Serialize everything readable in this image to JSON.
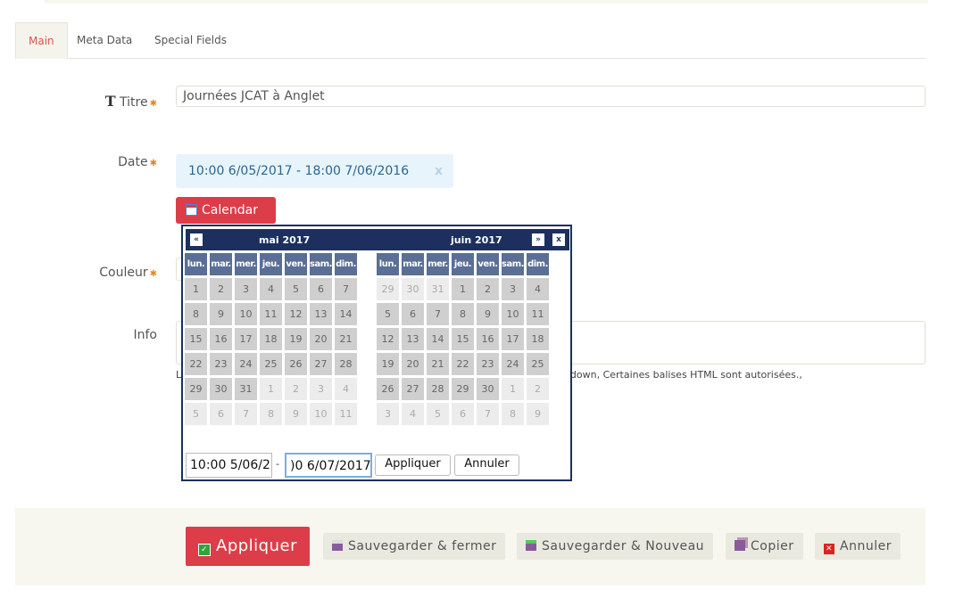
{
  "tabs": [
    {
      "label": "Main"
    },
    {
      "label": "Meta Data"
    },
    {
      "label": "Special Fields"
    }
  ],
  "form": {
    "title_label": "Titre",
    "title_value": "Journées JCAT à Anglet",
    "date_label": "Date",
    "date_value": "10:00 6/05/2017 - 18:00 7/06/2016",
    "date_clear": "x",
    "calendar_button": "Calendar",
    "color_label": "Couleur",
    "info_label": "Info",
    "hint_start": "L",
    "hint_end": "rkdown, Certaines balises HTML sont autorisées.,"
  },
  "calendar": {
    "prev": "«",
    "next": "»",
    "close": "x",
    "months": [
      {
        "title": "mai 2017",
        "weekdays": [
          "lun.",
          "mar.",
          "mer.",
          "jeu.",
          "ven.",
          "sam.",
          "dim."
        ],
        "days": [
          [
            "1",
            "2",
            "3",
            "4",
            "5",
            "6",
            "7"
          ],
          [
            "8",
            "9",
            "10",
            "11",
            "12",
            "13",
            "14"
          ],
          [
            "15",
            "16",
            "17",
            "18",
            "19",
            "20",
            "21"
          ],
          [
            "22",
            "23",
            "24",
            "25",
            "26",
            "27",
            "28"
          ],
          [
            "29",
            "30",
            "31",
            "1",
            "2",
            "3",
            "4"
          ],
          [
            "5",
            "6",
            "7",
            "8",
            "9",
            "10",
            "11"
          ]
        ],
        "first_in_month": 0,
        "last_in_month": 30
      },
      {
        "title": "juin 2017",
        "weekdays": [
          "lun.",
          "mar.",
          "mer.",
          "jeu.",
          "ven.",
          "sam.",
          "dim."
        ],
        "days": [
          [
            "29",
            "30",
            "31",
            "1",
            "2",
            "3",
            "4"
          ],
          [
            "5",
            "6",
            "7",
            "8",
            "9",
            "10",
            "11"
          ],
          [
            "12",
            "13",
            "14",
            "15",
            "16",
            "17",
            "18"
          ],
          [
            "19",
            "20",
            "21",
            "22",
            "23",
            "24",
            "25"
          ],
          [
            "26",
            "27",
            "28",
            "29",
            "30",
            "1",
            "2"
          ],
          [
            "3",
            "4",
            "5",
            "6",
            "7",
            "8",
            "9"
          ]
        ],
        "first_in_month": 3,
        "last_in_month": 32
      }
    ],
    "start_input": "10:00 5/06/2",
    "separator": "-",
    "end_input": ")0 6/07/2017",
    "apply": "Appliquer",
    "cancel": "Annuler"
  },
  "footer": {
    "apply": "Appliquer",
    "save_close": "Sauvegarder & fermer",
    "save_new": "Sauvegarder & Nouveau",
    "copy": "Copier",
    "cancel": "Annuler"
  },
  "colors": {
    "accent": "#dc3d48",
    "calendar_header": "#1c2f5f",
    "weekday_header": "#5a6e96"
  }
}
